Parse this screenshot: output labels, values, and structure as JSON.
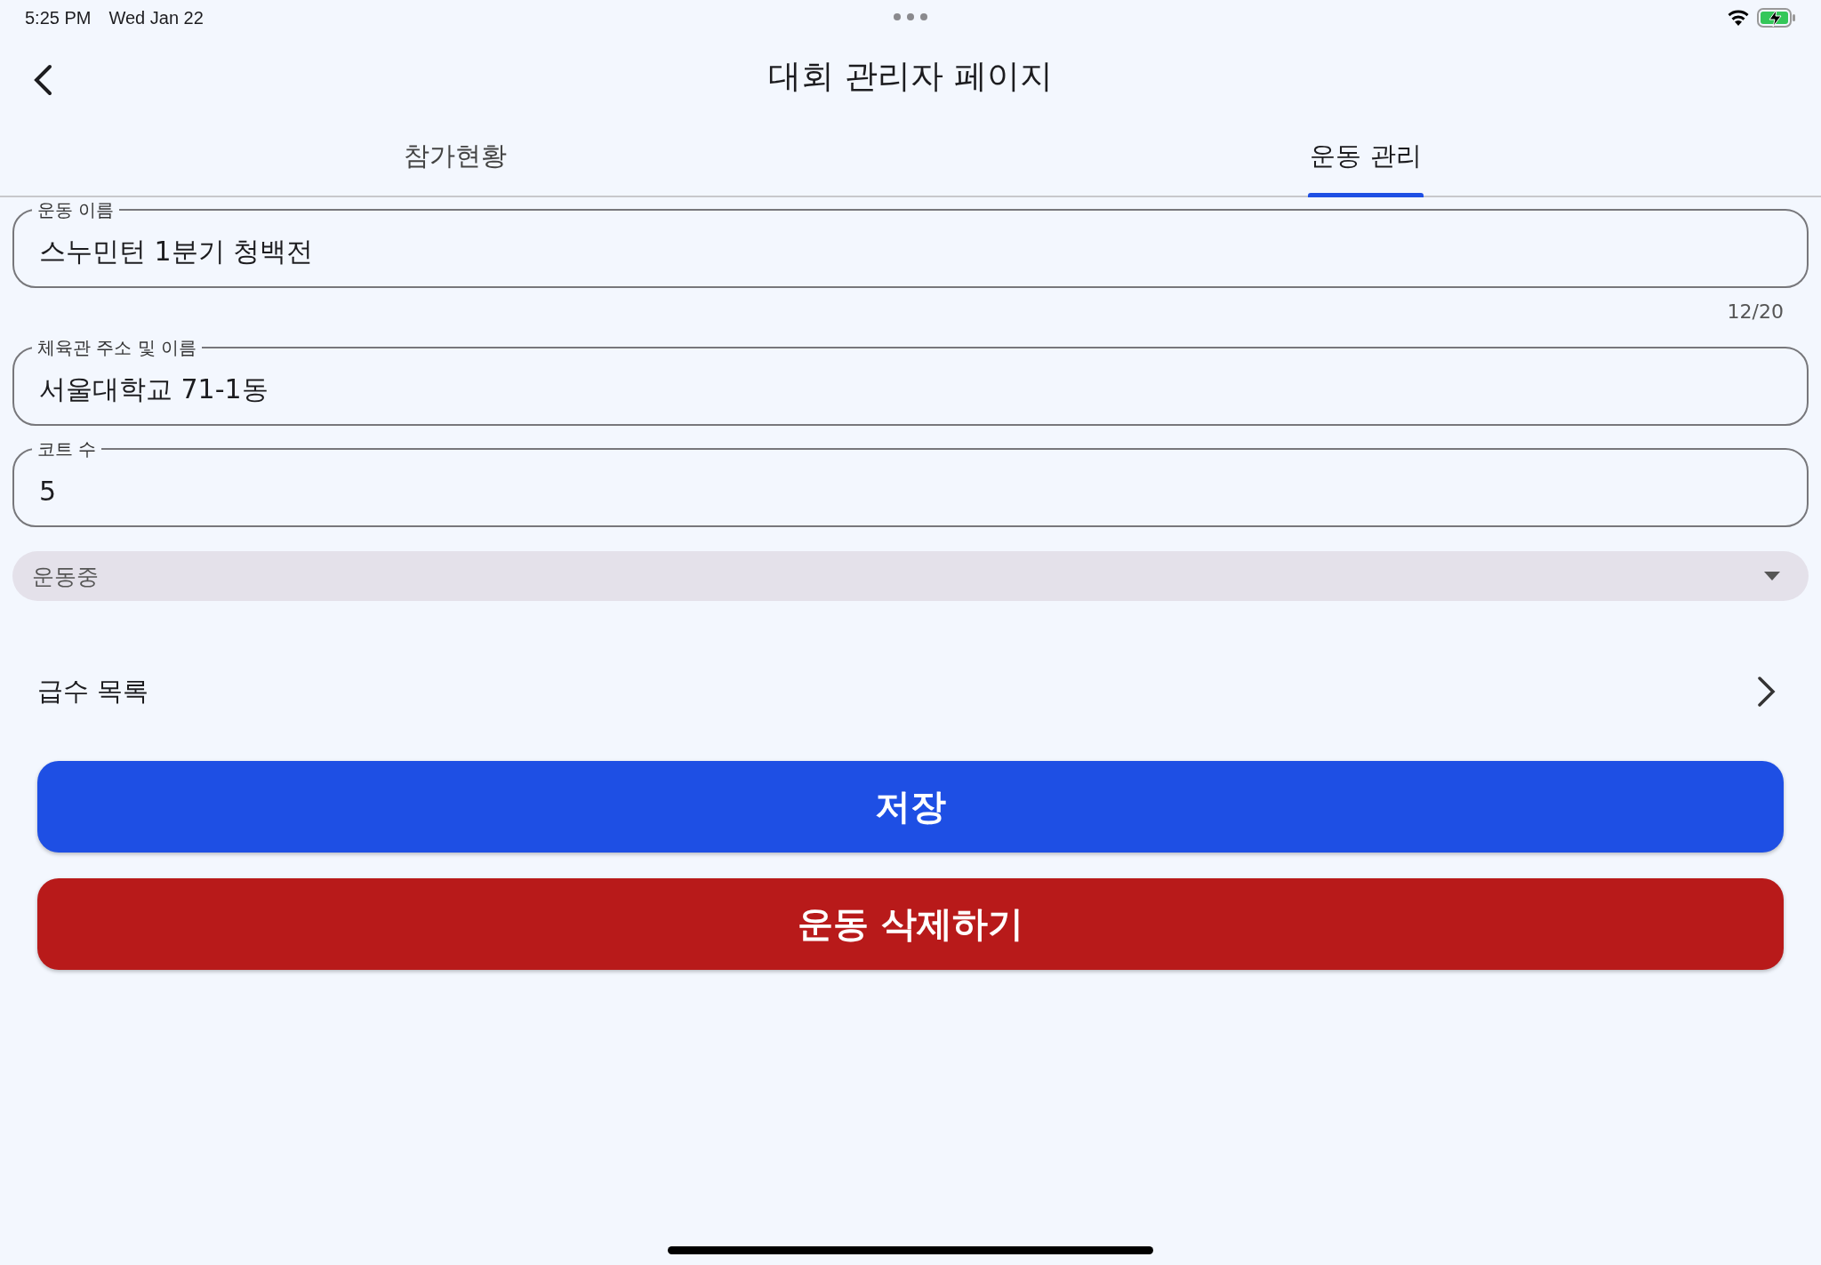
{
  "status_bar": {
    "time": "5:25 PM",
    "date": "Wed Jan 22"
  },
  "header": {
    "title": "대회 관리자 페이지"
  },
  "tabs": [
    {
      "label": "참가현황",
      "selected": false
    },
    {
      "label": "운동 관리",
      "selected": true
    }
  ],
  "fields": [
    {
      "label": "운동 이름",
      "value": "스누민턴 1분기 청백전",
      "counter": "12/20"
    },
    {
      "label": "체육관 주소 및 이름",
      "value": "서울대학교 71-1동"
    },
    {
      "label": "코트 수",
      "value": "5"
    }
  ],
  "status_select": {
    "value": "운동중"
  },
  "grade_list": {
    "label": "급수 목록"
  },
  "buttons": [
    {
      "label": "저장",
      "kind": "primary"
    },
    {
      "label": "운동 삭제하기",
      "kind": "danger"
    }
  ]
}
